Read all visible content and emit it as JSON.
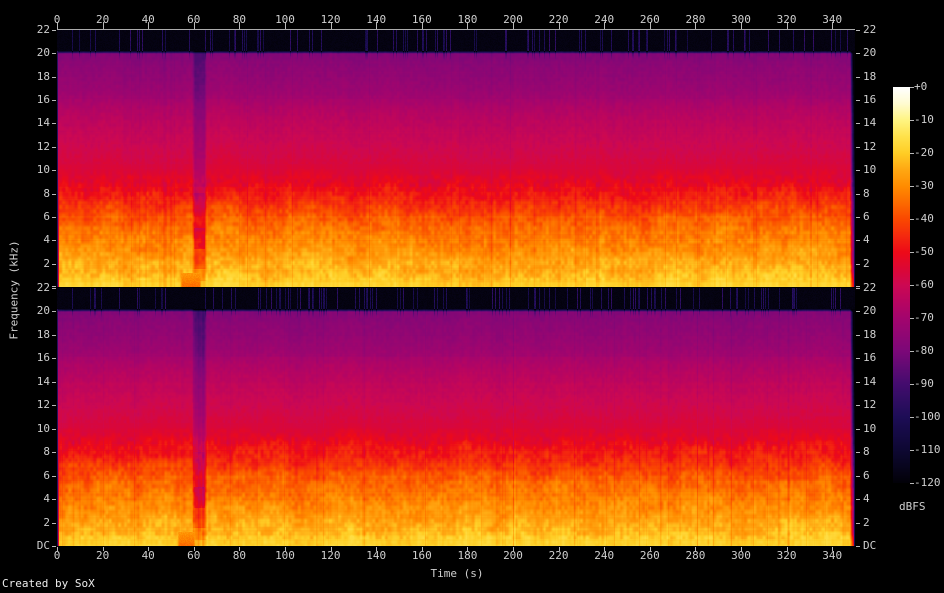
{
  "meta": {
    "credit": "Created by SoX"
  },
  "colors": {
    "background": "#000000",
    "axis_text": "#cfcfcf",
    "tick_mark": "#b8b8b8",
    "axis_line": "#ababab",
    "credit_text": "#ededed"
  },
  "axis_titles": {
    "x": "Time (s)",
    "y": "Frequency (kHz)",
    "z": "dBFS"
  },
  "time_axis": {
    "tick_labels": [
      "0",
      "20",
      "40",
      "60",
      "80",
      "100",
      "120",
      "140",
      "160",
      "180",
      "200",
      "220",
      "240",
      "260",
      "280",
      "300",
      "320",
      "340"
    ],
    "range_s": [
      0,
      350
    ]
  },
  "freq_axis": {
    "panel_tick_labels": [
      "22",
      "20",
      "18",
      "16",
      "14",
      "12",
      "10",
      "8",
      "6",
      "4",
      "2"
    ],
    "dc_label": "DC",
    "range_khz": [
      0,
      22
    ],
    "panels": 2
  },
  "colorbar": {
    "tick_labels": [
      "+0",
      "-10",
      "-20",
      "-30",
      "-40",
      "-50",
      "-60",
      "-70",
      "-80",
      "-90",
      "-100",
      "-110",
      "-120"
    ],
    "unit": "dBFS"
  },
  "chart_data": {
    "type": "heatmap",
    "subtype": "audio_spectrogram",
    "tool": "SoX",
    "channels": 2,
    "channel_layout": "two stacked panels (stereo), top and bottom",
    "xlabel": "Time (s)",
    "ylabel": "Frequency (kHz)",
    "zlabel": "dBFS",
    "x_range": [
      0,
      350
    ],
    "x_ticks": [
      0,
      20,
      40,
      60,
      80,
      100,
      120,
      140,
      160,
      180,
      200,
      220,
      240,
      260,
      280,
      300,
      320,
      340
    ],
    "y_range": [
      0,
      22
    ],
    "y_ticks": [
      22,
      20,
      18,
      16,
      14,
      12,
      10,
      8,
      6,
      4,
      2,
      0
    ],
    "z_range": [
      0,
      -120
    ],
    "z_ticks": [
      0,
      -10,
      -20,
      -30,
      -40,
      -50,
      -60,
      -70,
      -80,
      -90,
      -100,
      -110,
      -120
    ],
    "gridlines": false,
    "colorbar_position": "right",
    "palette_stops_db_hex": [
      [
        0,
        "#ffffff"
      ],
      [
        -5,
        "#fffbd0"
      ],
      [
        -10,
        "#fff480"
      ],
      [
        -15,
        "#ffe14a"
      ],
      [
        -20,
        "#ffcd25"
      ],
      [
        -25,
        "#ffa712"
      ],
      [
        -30,
        "#ff8c00"
      ],
      [
        -35,
        "#fc6a00"
      ],
      [
        -40,
        "#fa4800"
      ],
      [
        -45,
        "#f42a0e"
      ],
      [
        -50,
        "#ed0a18"
      ],
      [
        -55,
        "#dc0734"
      ],
      [
        -60,
        "#cc0852"
      ],
      [
        -65,
        "#b80560"
      ],
      [
        -70,
        "#a3056d"
      ],
      [
        -75,
        "#900673"
      ],
      [
        -80,
        "#7c0878"
      ],
      [
        -85,
        "#600a73"
      ],
      [
        -90,
        "#440c6e"
      ],
      [
        -95,
        "#300d62"
      ],
      [
        -100,
        "#1d0d56"
      ],
      [
        -105,
        "#150a44"
      ],
      [
        -110,
        "#0e0833"
      ],
      [
        -115,
        "#08051e"
      ],
      [
        -120,
        "#020108"
      ]
    ],
    "mean_spectrum_dbfs": [
      [
        0,
        -20.5
      ],
      [
        0.3,
        -21
      ],
      [
        0.7,
        -23
      ],
      [
        1,
        -24.5
      ],
      [
        1.5,
        -26
      ],
      [
        2,
        -26.5
      ],
      [
        2.5,
        -29
      ],
      [
        3,
        -30.5
      ],
      [
        3.5,
        -32
      ],
      [
        4,
        -33.5
      ],
      [
        4.5,
        -35
      ],
      [
        5,
        -36.5
      ],
      [
        5.5,
        -38
      ],
      [
        6,
        -40
      ],
      [
        6.5,
        -42.5
      ],
      [
        7,
        -45
      ],
      [
        7.5,
        -47.5
      ],
      [
        8,
        -50
      ],
      [
        9,
        -53.5
      ],
      [
        10,
        -56.5
      ],
      [
        11,
        -58.5
      ],
      [
        12,
        -60.5
      ],
      [
        13,
        -62.5
      ],
      [
        14,
        -64.5
      ],
      [
        15,
        -67
      ],
      [
        16,
        -70
      ],
      [
        17,
        -72.5
      ],
      [
        18,
        -74.5
      ],
      [
        19,
        -76
      ],
      [
        20,
        -78.5
      ],
      [
        20.25,
        -118
      ],
      [
        22,
        -118.5
      ]
    ],
    "features": [
      {
        "name": "hf-cutoff",
        "freq_khz": 20.1,
        "desc": "spectral content ends near 20.1 kHz; black band above up to 22 kHz with sparse dark-blue transient spikes"
      },
      {
        "name": "transient-spikes",
        "desc": "vertical blue hairlines in the 20-22 kHz black band; sparser in top channel, denser in bottom channel especially after t=80 s"
      },
      {
        "name": "quiet-passage",
        "time_s": [
          59,
          65.5
        ],
        "desc": "darker reddish column through both channels (gap between tracks)"
      },
      {
        "name": "low-freq-hot-blob",
        "time_s": [
          53,
          63
        ],
        "freq_khz": [
          0.1,
          1.1
        ],
        "desc": "orange-red blotch near DC in both channels just before the quiet passage"
      },
      {
        "name": "signal-end",
        "time_s": [
          348,
          350
        ],
        "desc": "dark purple column at the right edge where audio stops"
      },
      {
        "name": "bright-bass-band",
        "freq_khz": [
          0,
          2
        ],
        "desc": "continuous bright yellow band near DC, about -20 to -26 dBFS"
      }
    ]
  }
}
